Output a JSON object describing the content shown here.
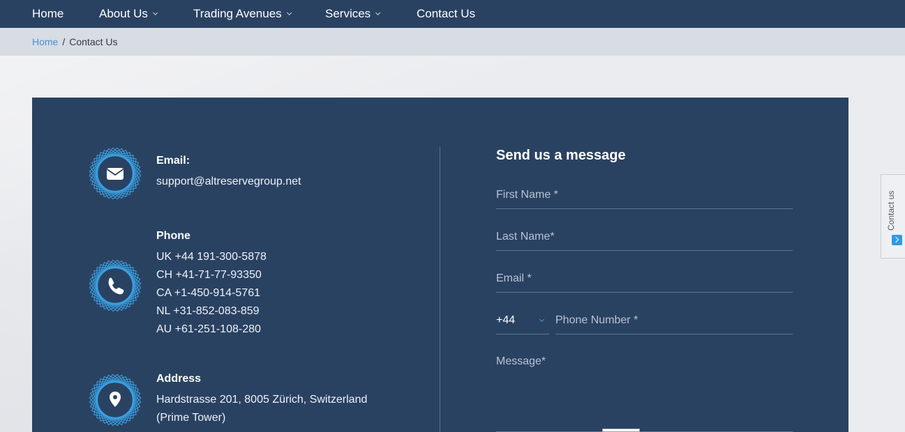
{
  "nav": {
    "items": [
      {
        "label": "Home",
        "has_dropdown": false
      },
      {
        "label": "About Us",
        "has_dropdown": true
      },
      {
        "label": "Trading Avenues",
        "has_dropdown": true
      },
      {
        "label": "Services",
        "has_dropdown": true
      },
      {
        "label": "Contact Us",
        "has_dropdown": false
      }
    ]
  },
  "breadcrumb": {
    "home": "Home",
    "separator": "/",
    "current": "Contact Us"
  },
  "contact_info": {
    "email": {
      "icon": "envelope-icon",
      "title": "Email:",
      "value": "support@altreservegroup.net"
    },
    "phone": {
      "icon": "phone-icon",
      "title": "Phone",
      "lines": [
        "UK +44 191-300-5878",
        "CH +41-71-77-93350",
        "CA +1-450-914-5761",
        "NL +31-852-083-859",
        "AU +61-251-108-280"
      ]
    },
    "address": {
      "icon": "map-pin-icon",
      "title": "Address",
      "lines": [
        "Hardstrasse 201, 8005 Zürich, Switzerland",
        "(Prime Tower)"
      ]
    }
  },
  "form": {
    "title": "Send us a message",
    "first_name_placeholder": "First Name *",
    "last_name_placeholder": "Last Name*",
    "email_placeholder": "Email *",
    "country_code": "+44",
    "phone_placeholder": "Phone Number *",
    "message_placeholder": "Message*"
  },
  "side_tab": {
    "label": "Contact us",
    "icon": "chevron-right-icon"
  },
  "colors": {
    "nav_bg": "#2a4262",
    "panel_bg": "#2a4262",
    "accent": "#4a90d9",
    "badge_blue": "#3a9fe0"
  }
}
